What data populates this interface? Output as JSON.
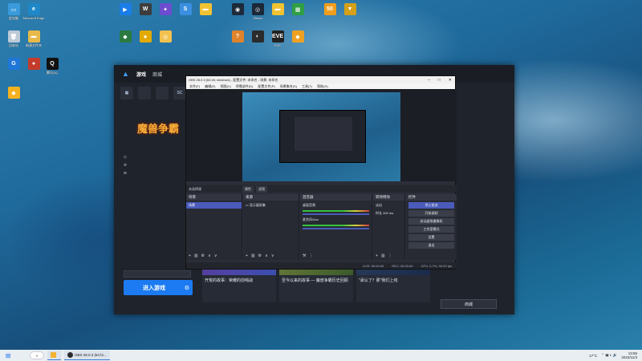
{
  "desktop_icons": [
    {
      "label": "此电脑",
      "color": "#3a9bdc",
      "glyph": "▭"
    },
    {
      "label": "Microsoft Edge",
      "color": "#1e88c8",
      "glyph": "e"
    },
    {
      "label": "回收站",
      "color": "#bcc9d6",
      "glyph": "🗑"
    },
    {
      "label": "新建文件夹",
      "color": "#e8b949",
      "glyph": "▬"
    },
    {
      "label": "",
      "color": "#1f77d8",
      "glyph": "G"
    },
    {
      "label": "",
      "color": "#c43b2c",
      "glyph": "●"
    },
    {
      "label": "腾讯QQ",
      "color": "#111111",
      "glyph": "Q"
    },
    {
      "label": "",
      "color": "#f5b21f",
      "glyph": "◆"
    },
    {
      "label": "",
      "color": "#1a7de8",
      "glyph": "▶"
    },
    {
      "label": "",
      "color": "#3d3d3d",
      "glyph": "W"
    },
    {
      "label": "",
      "color": "#6c4ccf",
      "glyph": "✦"
    },
    {
      "label": "",
      "color": "#3b8fe0",
      "glyph": "S"
    },
    {
      "label": "",
      "color": "#f1c232",
      "glyph": "▬"
    },
    {
      "label": "",
      "color": "#1d2a3a",
      "glyph": "◉"
    },
    {
      "label": "Steam",
      "color": "#1b2838",
      "glyph": "◎"
    },
    {
      "label": "",
      "color": "#f1c232",
      "glyph": "▬"
    },
    {
      "label": "",
      "color": "#2f9e44",
      "glyph": "▦"
    },
    {
      "label": "",
      "color": "#f29d1c",
      "glyph": "50"
    },
    {
      "label": "",
      "color": "#d4a017",
      "glyph": "▼"
    },
    {
      "label": "",
      "color": "#2a7a3f",
      "glyph": "◆"
    },
    {
      "label": "",
      "color": "#e2a900",
      "glyph": "★"
    },
    {
      "label": "",
      "color": "#f2c14e",
      "glyph": "◎"
    },
    {
      "label": "",
      "color": "#e0832a",
      "glyph": "?"
    },
    {
      "label": "",
      "color": "#2b2b2b",
      "glyph": "◐"
    },
    {
      "label": "EVE",
      "color": "#222222",
      "glyph": "EVE"
    },
    {
      "label": "",
      "color": "#f0a020",
      "glyph": "◆"
    }
  ],
  "launcher": {
    "nav": [
      "游戏",
      "商城"
    ],
    "tabs": [
      "",
      "",
      "",
      "SC",
      "W"
    ],
    "game_logo": "魔兽争霸",
    "menu": [
      "",
      "",
      ""
    ],
    "account_label": "",
    "region_value": "",
    "play_label": "进入游戏",
    "version": "",
    "news": [
      {
        "caption": "",
        "title": "开荒的故事：荣耀的前哨战"
      },
      {
        "caption": "",
        "title": "至今以来的故事 — 魔兽争霸历史回顾"
      },
      {
        "caption": "",
        "title": "\"承认了？那\"我们上线"
      }
    ],
    "right_panel": [
      "",
      "",
      "",
      "",
      ""
    ],
    "shop_button": "商城"
  },
  "obs": {
    "title": "OBS 28.0.3 (64 bit, windows) - 配置文件: 未命名 - 场景: 未命名",
    "menu": [
      "文件(F)",
      "编辑(E)",
      "视图(V)",
      "停靠部件(D)",
      "配置文件(P)",
      "场景集合(S)",
      "工具(T)",
      "帮助(H)"
    ],
    "mid_left": "未选择源",
    "mid_tabs": [
      "属性",
      "滤镜"
    ],
    "docks": {
      "scenes": {
        "header": "场景",
        "items": [
          "场景"
        ]
      },
      "sources": {
        "header": "来源",
        "items": [
          "显示器采集"
        ]
      },
      "mixer": {
        "header": "混音器",
        "items": [
          "桌面音频",
          "麦克风/Aux"
        ]
      },
      "transitions": {
        "header": "转场特效",
        "items": [
          "淡出",
          "时长 300 ms"
        ]
      },
      "controls": {
        "header": "控件",
        "items": [
          "停止推流",
          "开始录制",
          "启动虚拟摄像机",
          "工作室模式",
          "设置",
          "退出"
        ]
      }
    },
    "status": [
      "LIVE: 00:00:00",
      "REC: 00:00:00",
      "CPU: 0.7%, 30.00 fps"
    ]
  },
  "taskbar": {
    "apps": [
      {
        "label": "",
        "color": "#f2b233"
      },
      {
        "label": "OBS 28.0.3 (64 bi...",
        "color": "#2a2a2a"
      }
    ],
    "weather": "17°C",
    "time": "13:56",
    "date": "2022/11/3"
  }
}
